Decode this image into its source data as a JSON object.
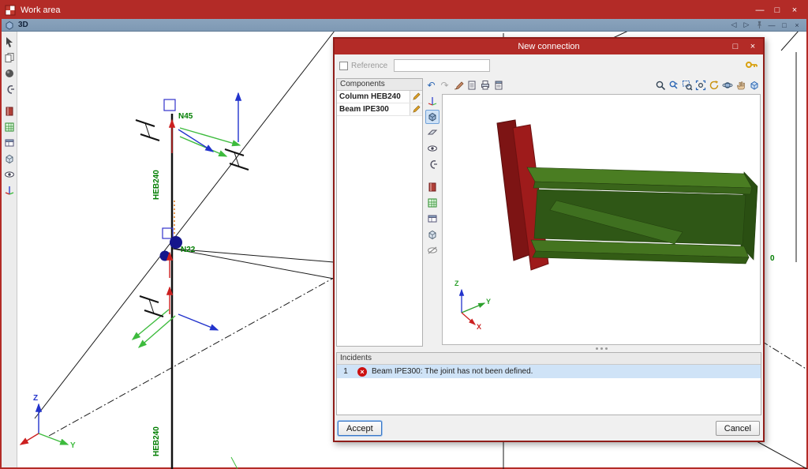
{
  "app": {
    "title": "Work area",
    "view_label": "3D"
  },
  "icons": {
    "minimize": "—",
    "maximize": "□",
    "close": "×",
    "nav_left": "◁",
    "nav_right": "▷",
    "undo": "↶",
    "redo": "↷",
    "error_mark": "×"
  },
  "main_canvas": {
    "nodes": [
      {
        "label": "N45"
      },
      {
        "label": "N22"
      }
    ],
    "members": [
      {
        "label": "HEB240"
      },
      {
        "label": "HEB240"
      }
    ],
    "partial_label": "0",
    "axes": {
      "x": "X",
      "y": "Y",
      "z": "Z"
    }
  },
  "dialog": {
    "title": "New connection",
    "reference": {
      "label": "Reference",
      "value": ""
    },
    "components": {
      "header": "Components",
      "items": [
        {
          "label": "Column HEB240"
        },
        {
          "label": "Beam IPE300"
        }
      ]
    },
    "viewport": {
      "axes": {
        "x": "X",
        "y": "Y",
        "z": "Z"
      }
    },
    "incidents": {
      "header": "Incidents",
      "rows": [
        {
          "num": "1",
          "message": "Beam IPE300: The joint has not been defined."
        }
      ]
    },
    "buttons": {
      "accept": "Accept",
      "cancel": "Cancel"
    }
  },
  "colors": {
    "titlebar": "#b32b27",
    "view_bar": "#7e99b4",
    "accent": "#3a6ea5",
    "error": "#cc1111",
    "highlight_row": "#cfe3f7",
    "beam_green": "#3f6b1f",
    "plate_red": "#9e1b1b",
    "label_green": "#007e00"
  }
}
